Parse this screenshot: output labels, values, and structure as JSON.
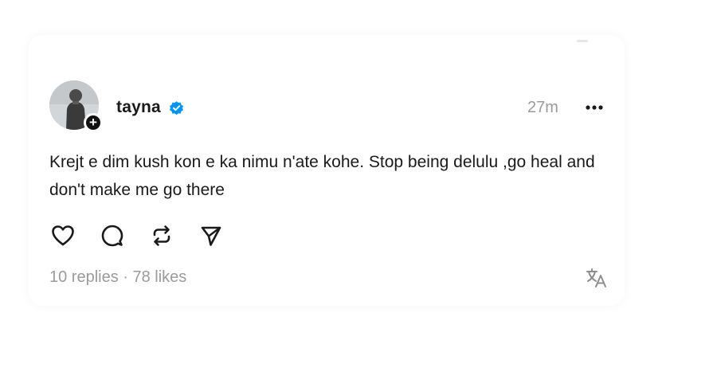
{
  "post": {
    "username": "tayna",
    "timestamp": "27m",
    "text": "Krejt e dim kush kon e ka nimu n'ate kohe. Stop being delulu ,go heal and don't make me go there",
    "stats": "10 replies · 78 likes"
  },
  "icons": {
    "verified": "verified-badge-icon",
    "more": "more-options-icon",
    "like": "heart-icon",
    "reply": "comment-bubble-icon",
    "repost": "repost-icon",
    "share": "send-icon",
    "translate": "translate-icon",
    "follow": "plus-icon"
  },
  "colors": {
    "verified_blue": "#0095f6",
    "text": "#1a1a1a",
    "muted": "#9b9b9b"
  }
}
